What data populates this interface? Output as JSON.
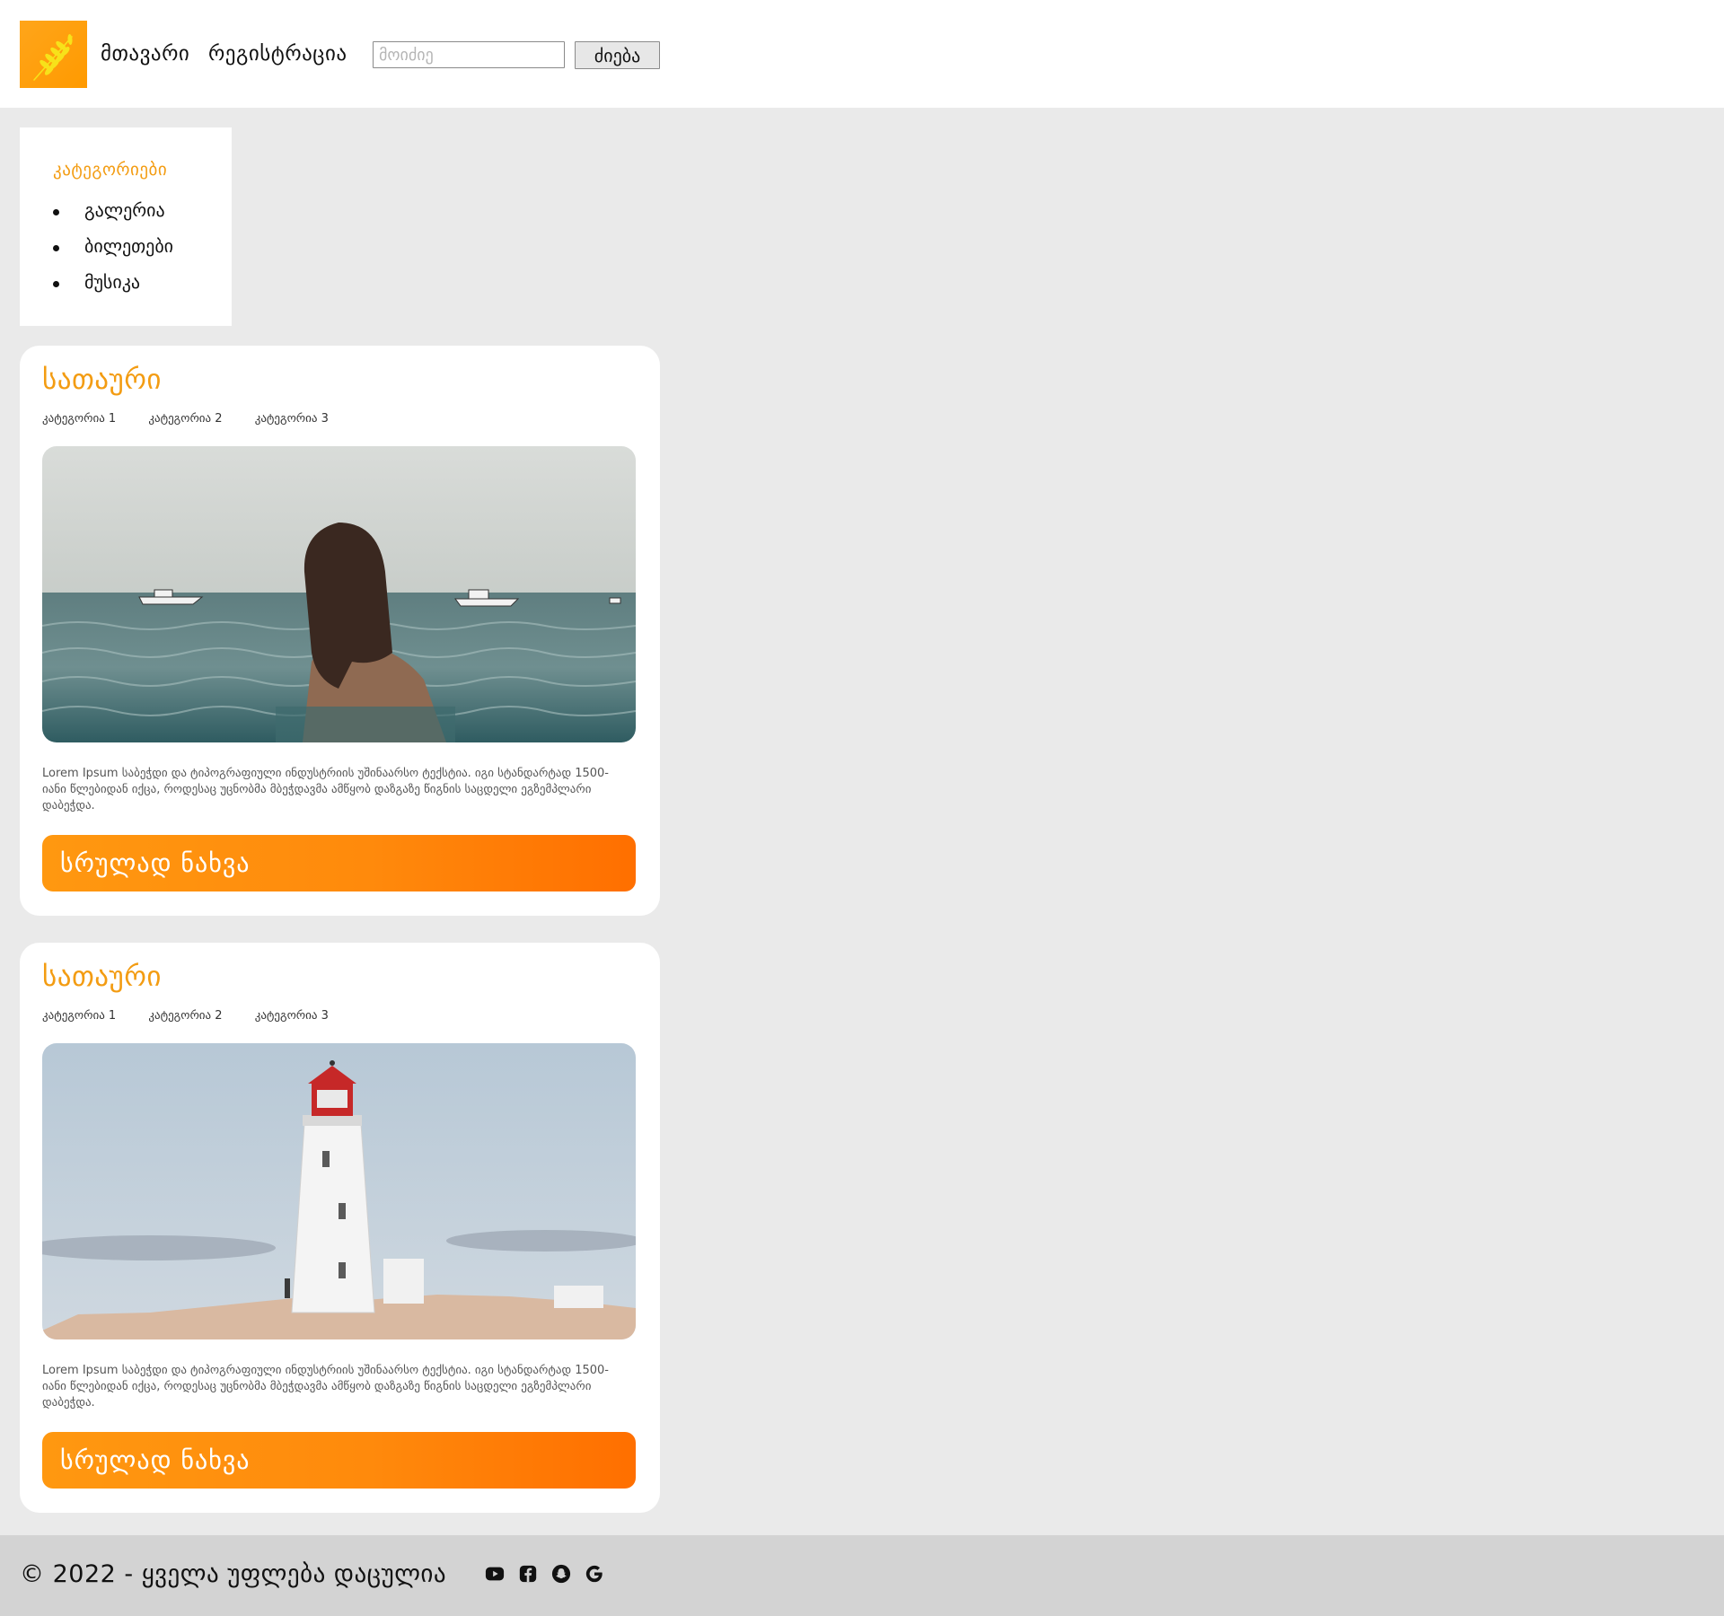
{
  "header": {
    "nav": [
      {
        "label": "მთავარი"
      },
      {
        "label": "რეგისტრაცია"
      }
    ],
    "search": {
      "placeholder": "მოიძიე",
      "button_label": "ძიება"
    }
  },
  "sidebar": {
    "title": "კატეგორიები",
    "items": [
      {
        "label": "გალერია"
      },
      {
        "label": "ბილეთები"
      },
      {
        "label": "მუსიკა"
      }
    ]
  },
  "posts": [
    {
      "title": "სათაური",
      "tags": [
        "კატეგორია 1",
        "კატეგორია 2",
        "კატეგორია 3"
      ],
      "text": "Lorem Ipsum საბეჭდი და ტიპოგრაფიული ინდუსტრიის უშინაარსო ტექსტია. იგი სტანდარტად 1500-იანი წლებიდან იქცა, როდესაც უცნობმა მბეჭდავმა ამწყობ დაზგაზე წიგნის საცდელი ეგზემპლარი დაბეჭდა.",
      "button_label": "სრულად ნახვა",
      "image": "woman-swimming-in-sea"
    },
    {
      "title": "სათაური",
      "tags": [
        "კატეგორია 1",
        "კატეგორია 2",
        "კატეგორია 3"
      ],
      "text": "Lorem Ipsum საბეჭდი და ტიპოგრაფიული ინდუსტრიის უშინაარსო ტექსტია. იგი სტანდარტად 1500-იანი წლებიდან იქცა, როდესაც უცნობმა მბეჭდავმა ამწყობ დაზგაზე წიგნის საცდელი ეგზემპლარი დაბეჭდა.",
      "button_label": "სრულად ნახვა",
      "image": "white-lighthouse-on-rocks"
    }
  ],
  "footer": {
    "text": "© 2022 - ყველა უფლება დაცულია",
    "social": [
      "youtube-icon",
      "facebook-icon",
      "snapchat-icon",
      "google-icon"
    ]
  },
  "colors": {
    "accent": "#f39c12",
    "button_gradient_start": "#ff9810",
    "button_gradient_end": "#ff6f00",
    "page_bg": "#eaeaea",
    "footer_bg": "#d3d3d3"
  }
}
